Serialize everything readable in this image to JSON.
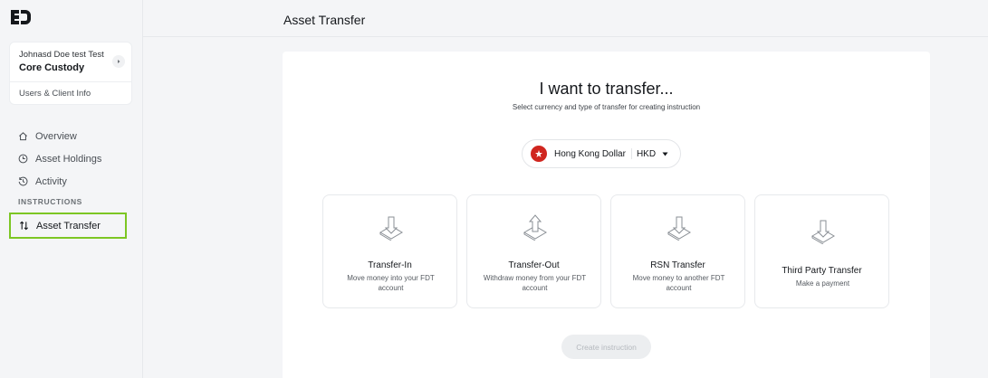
{
  "sidebar": {
    "account": {
      "user_name": "Johnasd Doe test Test",
      "product": "Core Custody",
      "link": "Users & Client Info"
    },
    "nav": [
      {
        "label": "Overview",
        "icon": "home-icon"
      },
      {
        "label": "Asset Holdings",
        "icon": "clock-icon"
      },
      {
        "label": "Activity",
        "icon": "history-icon"
      }
    ],
    "section_label": "INSTRUCTIONS",
    "active_item": {
      "label": "Asset Transfer",
      "icon": "transfer-arrows-icon"
    },
    "highlight_color": "#7cc623"
  },
  "header": {
    "title": "Asset Transfer"
  },
  "main": {
    "heading": "I want to transfer...",
    "subheading": "Select currency and type of transfer for creating instruction",
    "currency": {
      "name": "Hong Kong Dollar",
      "code": "HKD",
      "flag_color": "#d0261f"
    },
    "options": [
      {
        "title": "Transfer-In",
        "description": "Move money into your FDT account"
      },
      {
        "title": "Transfer-Out",
        "description": "Withdraw money from your FDT account"
      },
      {
        "title": "RSN Transfer",
        "description": "Move money to another FDT account"
      },
      {
        "title": "Third Party Transfer",
        "description": "Make a payment"
      }
    ],
    "create_button": "Create instruction"
  }
}
